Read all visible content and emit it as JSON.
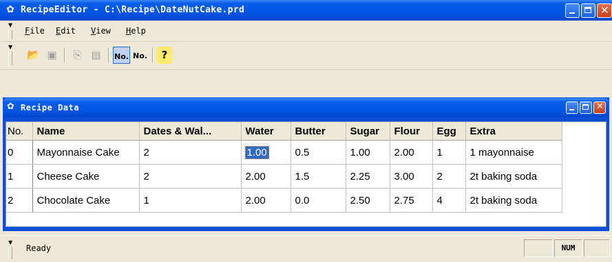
{
  "window": {
    "title": "RecipeEditor - C:\\Recipe\\DateNutCake.prd",
    "app_icon": "recipe-app-icon"
  },
  "menu": {
    "items": [
      {
        "label_first": "F",
        "label_rest": "ile"
      },
      {
        "label_first": "E",
        "label_rest": "dit"
      },
      {
        "label_first": "V",
        "label_rest": "iew"
      },
      {
        "label_first": "H",
        "label_rest": "elp"
      }
    ]
  },
  "toolbar": {
    "buttons": [
      {
        "icon": "open-folder-icon",
        "glyph": "📂",
        "enabled": true
      },
      {
        "icon": "save-icon",
        "glyph": "💾",
        "enabled": false
      },
      {
        "icon": "copy-icon",
        "glyph": "⎘",
        "enabled": false
      },
      {
        "icon": "paste-icon",
        "glyph": "📋",
        "enabled": false
      },
      {
        "icon": "record-number-view-icon",
        "glyph": "▤",
        "enabled": true,
        "pressed": true
      },
      {
        "icon": "record-number-form-icon",
        "glyph": "▦",
        "enabled": true
      },
      {
        "icon": "help-icon",
        "glyph": "?",
        "enabled": true
      }
    ]
  },
  "child_window": {
    "title": "Recipe Data"
  },
  "table": {
    "columns": [
      "No.",
      "Name",
      "Dates & Wal...",
      "Water",
      "Butter",
      "Sugar",
      "Flour",
      "Egg",
      "Extra"
    ],
    "rows": [
      [
        "0",
        "Mayonnaise Cake",
        "2",
        "1.00",
        "0.5",
        "1.00",
        "2.00",
        "1",
        "1 mayonnaise"
      ],
      [
        "1",
        "Cheese Cake",
        "2",
        "2.00",
        "1.5",
        "2.25",
        "3.00",
        "2",
        "2t baking soda"
      ],
      [
        "2",
        "Chocolate Cake",
        "1",
        "2.00",
        "0.0",
        "2.50",
        "2.75",
        "4",
        "2t baking soda"
      ]
    ],
    "selected_cell": {
      "row": 0,
      "col": 3
    }
  },
  "status": {
    "text": "Ready",
    "num_indicator": "NUM"
  },
  "colors": {
    "titlebar": "#0055e5",
    "selection": "#316ac5",
    "chrome": "#ece9d8"
  }
}
